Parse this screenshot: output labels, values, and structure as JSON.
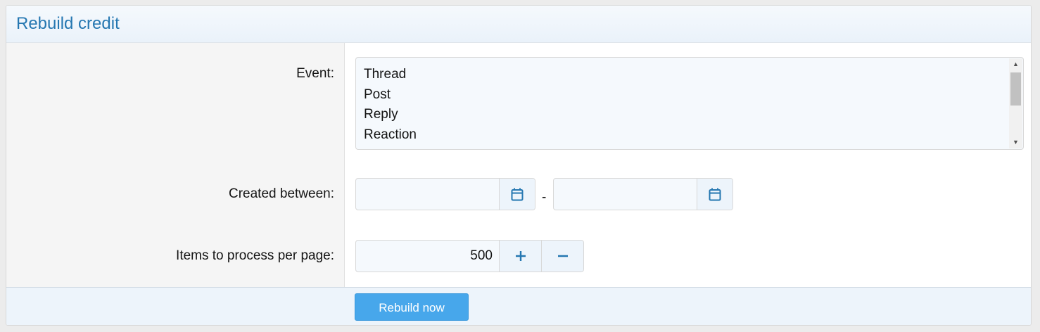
{
  "header": {
    "title": "Rebuild credit"
  },
  "form": {
    "event": {
      "label": "Event:",
      "options": [
        "Thread",
        "Post",
        "Reply",
        "Reaction"
      ]
    },
    "created_between": {
      "label": "Created between:",
      "start_value": "",
      "end_value": "",
      "separator": "-",
      "icon": "calendar-icon"
    },
    "items_per_page": {
      "label": "Items to process per page:",
      "value": "500",
      "increment_icon": "plus-icon",
      "decrement_icon": "minus-icon"
    }
  },
  "footer": {
    "submit_label": "Rebuild now"
  },
  "colors": {
    "title": "#2577b1",
    "button": "#47a7eb",
    "icon": "#2577b1"
  }
}
